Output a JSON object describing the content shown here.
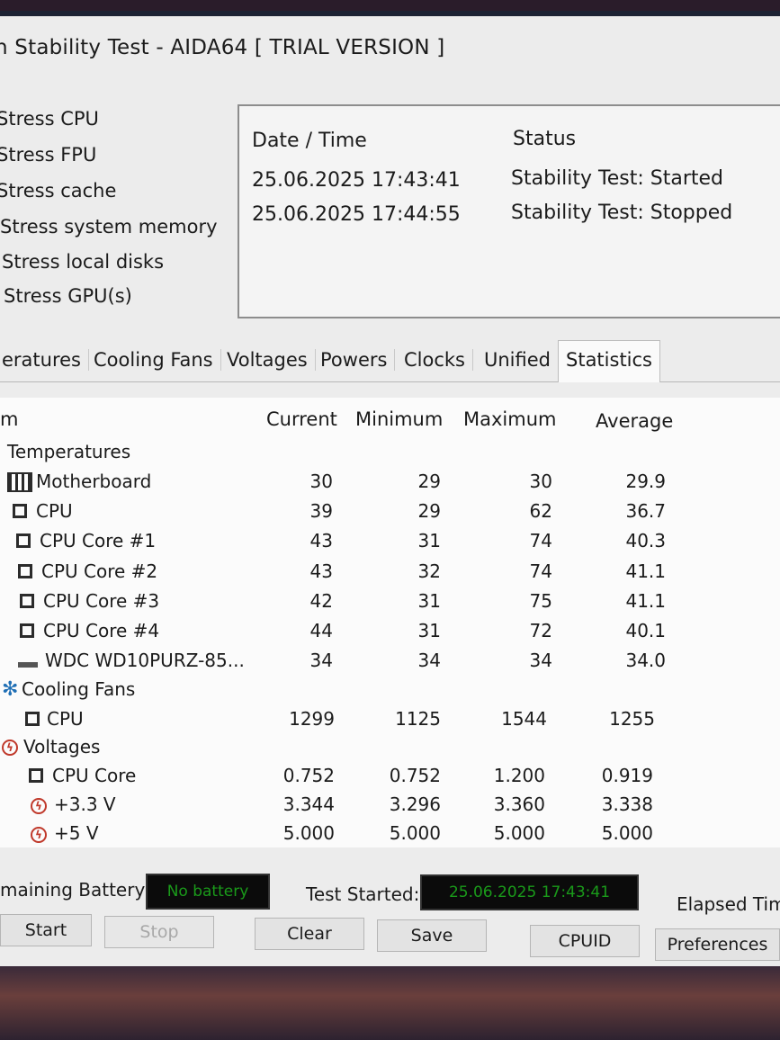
{
  "window": {
    "title_prefix": "n",
    "title": "Stability Test - AIDA64  [ TRIAL VERSION ]"
  },
  "stress_options": [
    "Stress CPU",
    "Stress FPU",
    "Stress cache",
    "Stress system memory",
    "Stress local disks",
    "Stress GPU(s)"
  ],
  "log": {
    "headers": {
      "datetime": "Date / Time",
      "status": "Status"
    },
    "rows": [
      {
        "datetime": "25.06.2025 17:43:41",
        "status": "Stability Test: Started"
      },
      {
        "datetime": "25.06.2025 17:44:55",
        "status": "Stability Test: Stopped"
      }
    ]
  },
  "tabs": [
    "eratures",
    "Cooling Fans",
    "Voltages",
    "Powers",
    "Clocks",
    "Unified",
    "Statistics"
  ],
  "active_tab": "Statistics",
  "stats": {
    "headers": {
      "item": "m",
      "current": "Current",
      "minimum": "Minimum",
      "maximum": "Maximum",
      "average": "Average"
    },
    "rows": [
      {
        "type": "group",
        "label": "Temperatures"
      },
      {
        "type": "item",
        "icon": "motherboard-icon",
        "label": "Motherboard",
        "current": "30",
        "minimum": "29",
        "maximum": "30",
        "average": "29.9"
      },
      {
        "type": "item",
        "icon": "cpu-icon",
        "label": "CPU",
        "current": "39",
        "minimum": "29",
        "maximum": "62",
        "average": "36.7"
      },
      {
        "type": "item",
        "icon": "cpu-icon",
        "label": "CPU Core #1",
        "current": "43",
        "minimum": "31",
        "maximum": "74",
        "average": "40.3"
      },
      {
        "type": "item",
        "icon": "cpu-icon",
        "label": "CPU Core #2",
        "current": "43",
        "minimum": "32",
        "maximum": "74",
        "average": "41.1"
      },
      {
        "type": "item",
        "icon": "cpu-icon",
        "label": "CPU Core #3",
        "current": "42",
        "minimum": "31",
        "maximum": "75",
        "average": "41.1"
      },
      {
        "type": "item",
        "icon": "cpu-icon",
        "label": "CPU Core #4",
        "current": "44",
        "minimum": "31",
        "maximum": "72",
        "average": "40.1"
      },
      {
        "type": "item",
        "icon": "hdd-icon",
        "label": "WDC WD10PURZ-85...",
        "current": "34",
        "minimum": "34",
        "maximum": "34",
        "average": "34.0"
      },
      {
        "type": "group",
        "icon": "fan-icon",
        "label": "Cooling Fans"
      },
      {
        "type": "item",
        "icon": "cpu-icon",
        "label": "CPU",
        "current": "1299",
        "minimum": "1125",
        "maximum": "1544",
        "average": "1255"
      },
      {
        "type": "group",
        "icon": "voltage-icon",
        "label": "Voltages"
      },
      {
        "type": "item",
        "icon": "cpu-icon",
        "label": "CPU Core",
        "current": "0.752",
        "minimum": "0.752",
        "maximum": "1.200",
        "average": "0.919"
      },
      {
        "type": "item",
        "icon": "voltage-icon",
        "label": "+3.3 V",
        "current": "3.344",
        "minimum": "3.296",
        "maximum": "3.360",
        "average": "3.338"
      },
      {
        "type": "item",
        "icon": "voltage-icon",
        "label": "+5 V",
        "current": "5.000",
        "minimum": "5.000",
        "maximum": "5.000",
        "average": "5.000"
      }
    ]
  },
  "status_bar": {
    "battery_label": "maining Battery:",
    "battery_value": "No battery",
    "test_started_label": "Test Started:",
    "test_started_value": "25.06.2025 17:43:41",
    "elapsed_label": "Elapsed Time"
  },
  "buttons": {
    "start": "Start",
    "stop": "Stop",
    "clear": "Clear",
    "save": "Save",
    "cpuid": "CPUID",
    "preferences": "Preferences"
  },
  "colors": {
    "lcd_bg": "#0b0b0b",
    "lcd_text": "#1a9a1a",
    "voltage_icon": "#c0392b",
    "fan_icon": "#1f6fb5"
  }
}
